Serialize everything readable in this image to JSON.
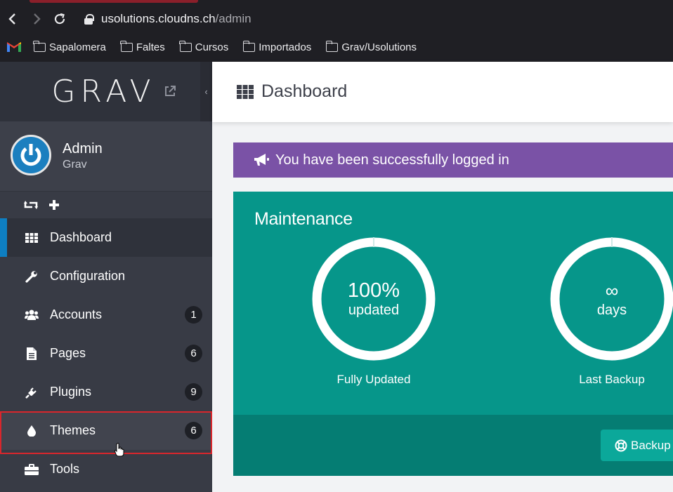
{
  "browser": {
    "url_host": "usolutions.cloudns.ch",
    "url_path": "/admin",
    "bookmarks": [
      "Sapalomera",
      "Faltes",
      "Cursos",
      "Importados",
      "Grav/Usolutions"
    ]
  },
  "sidebar": {
    "logo": "GRAV",
    "user": {
      "name": "Admin",
      "role": "Grav"
    },
    "items": [
      {
        "label": "Dashboard",
        "icon": "grid-icon",
        "badge": null,
        "active": true
      },
      {
        "label": "Configuration",
        "icon": "wrench-icon",
        "badge": null
      },
      {
        "label": "Accounts",
        "icon": "users-icon",
        "badge": "1"
      },
      {
        "label": "Pages",
        "icon": "file-icon",
        "badge": "6"
      },
      {
        "label": "Plugins",
        "icon": "plug-icon",
        "badge": "9"
      },
      {
        "label": "Themes",
        "icon": "tint-icon",
        "badge": "6"
      },
      {
        "label": "Tools",
        "icon": "briefcase-icon",
        "badge": null
      }
    ]
  },
  "header": {
    "title": "Dashboard"
  },
  "notice": {
    "text": "You have been successfully logged in"
  },
  "maintenance": {
    "title": "Maintenance",
    "updated": {
      "value": "100%",
      "unit": "updated",
      "label": "Fully Updated",
      "fill": 1.0
    },
    "backup": {
      "value": "∞",
      "unit": "days",
      "label": "Last Backup",
      "fill": 1.0
    },
    "backup_button": "Backup"
  },
  "colors": {
    "accent": "#0e7fc2",
    "notice": "#7a52a6",
    "maintenance": "#06968a",
    "highlight_border": "#d9262c"
  }
}
